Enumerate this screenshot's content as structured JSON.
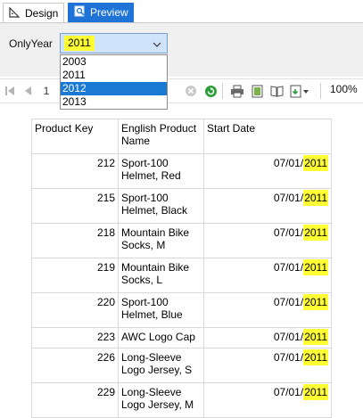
{
  "tabs": {
    "design_label": "Design",
    "preview_label": "Preview"
  },
  "parameters": {
    "label": "OnlyYear",
    "selected_value": "2011",
    "options": [
      "2003",
      "2011",
      "2012",
      "2013"
    ],
    "highlighted_option": "2012"
  },
  "toolbar": {
    "page_number": "1",
    "zoom": "100%"
  },
  "report": {
    "headers": [
      "Product Key",
      "English Product Name",
      "Start Date"
    ],
    "rows": [
      {
        "key": "212",
        "name": "Sport-100 Helmet, Red",
        "date_prefix": "07/01/",
        "year": "2011"
      },
      {
        "key": "215",
        "name": "Sport-100 Helmet, Black",
        "date_prefix": "07/01/",
        "year": "2011"
      },
      {
        "key": "218",
        "name": "Mountain Bike Socks, M",
        "date_prefix": "07/01/",
        "year": "2011"
      },
      {
        "key": "219",
        "name": "Mountain Bike Socks, L",
        "date_prefix": "07/01/",
        "year": "2011"
      },
      {
        "key": "220",
        "name": "Sport-100 Helmet, Blue",
        "date_prefix": "07/01/",
        "year": "2011"
      },
      {
        "key": "223",
        "name": "AWC Logo Cap",
        "date_prefix": "07/01/",
        "year": "2011"
      },
      {
        "key": "226",
        "name": "Long-Sleeve Logo Jersey, S",
        "date_prefix": "07/01/",
        "year": "2011"
      },
      {
        "key": "229",
        "name": "Long-Sleeve Logo Jersey, M",
        "date_prefix": "07/01/",
        "year": "2011"
      }
    ]
  },
  "colors": {
    "tab_active": "#1f73d6",
    "highlight": "#ffff33",
    "selected_option": "#1a79d2"
  }
}
